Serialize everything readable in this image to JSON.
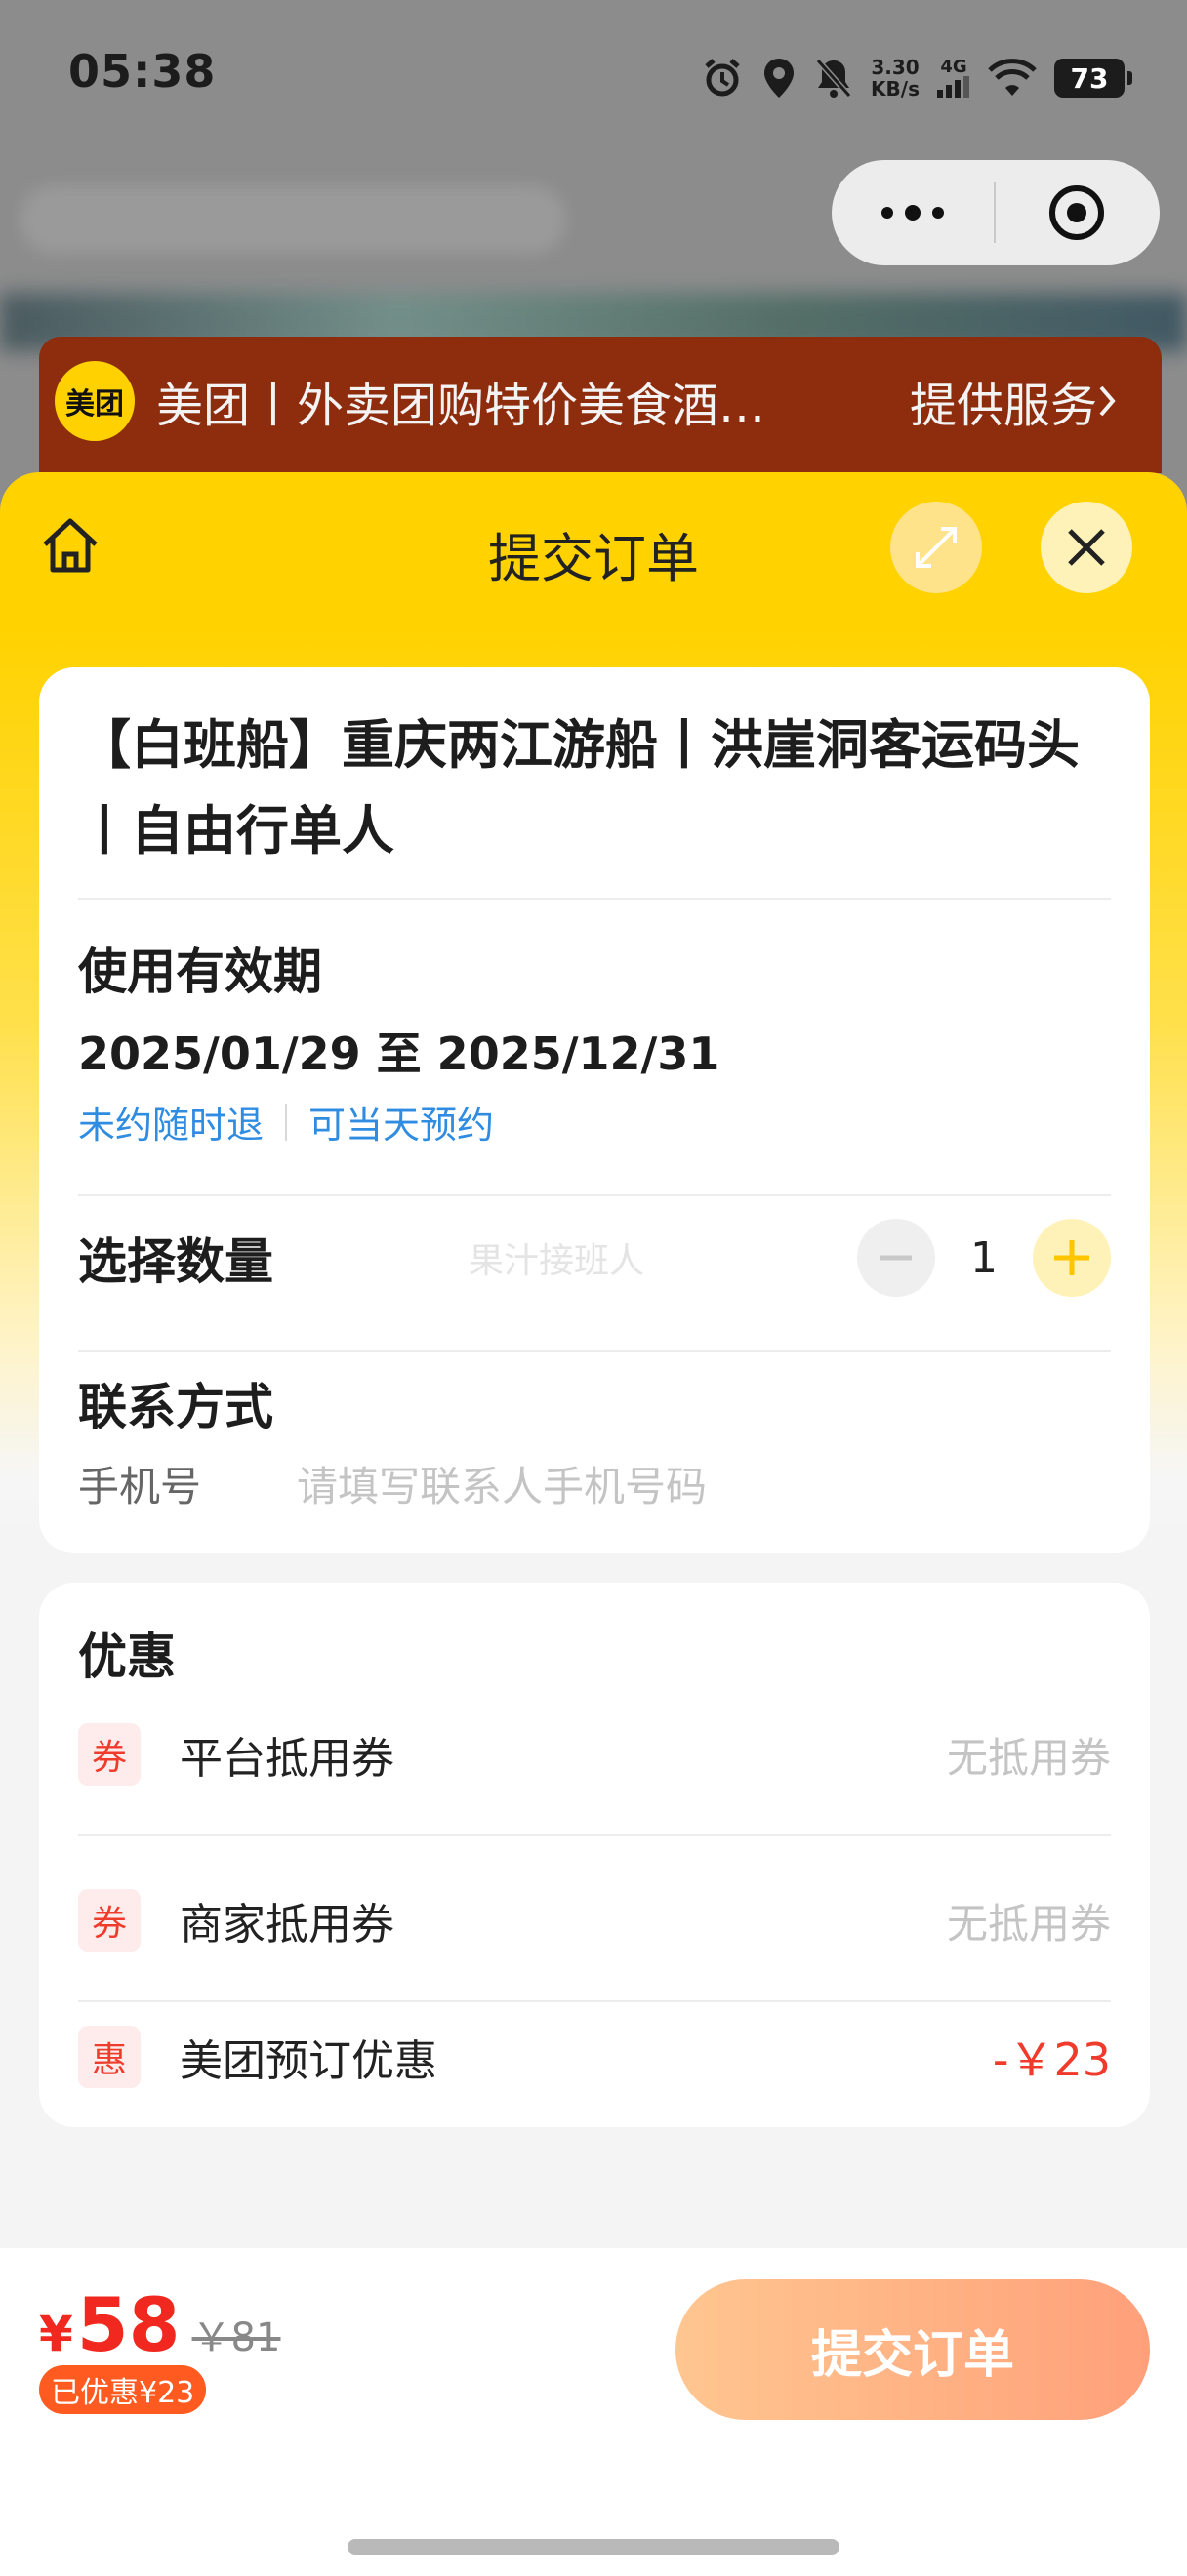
{
  "status_bar": {
    "time": "05:38",
    "net_speed_value": "3.30",
    "net_speed_unit": "KB/s",
    "network_type": "4G",
    "battery": "73"
  },
  "service_banner": {
    "logo_text": "美团",
    "title": "美团丨外卖团购特价美食酒…",
    "right_text": "提供服务"
  },
  "sheet": {
    "title": "提交订单"
  },
  "product": {
    "title": "【白班船】重庆两江游船丨洪崖洞客运码头丨自由行单人"
  },
  "validity": {
    "label": "使用有效期",
    "dates": "2025/01/29 至 2025/12/31",
    "tags": [
      "未约随时退",
      "可当天预约"
    ]
  },
  "quantity": {
    "label": "选择数量",
    "watermark": "果汁接班人",
    "value": "1"
  },
  "contact": {
    "label": "联系方式",
    "phone_label": "手机号",
    "phone_placeholder": "请填写联系人手机号码"
  },
  "discounts": {
    "title": "优惠",
    "items": [
      {
        "badge": "券",
        "name": "平台抵用券",
        "value": "无抵用券"
      },
      {
        "badge": "券",
        "name": "商家抵用券",
        "value": "无抵用券"
      },
      {
        "badge": "惠",
        "name": "美团预订优惠",
        "value": "-￥23"
      }
    ]
  },
  "footer": {
    "currency": "¥",
    "price": "58",
    "original_price": "￥81",
    "saved_text": "已优惠¥23",
    "submit_label": "提交订单"
  },
  "colors": {
    "brand_yellow": "#ffd200",
    "price_red": "#f0281f",
    "link_blue": "#2f8ce0",
    "submit_gradient_start": "#ffc690",
    "submit_gradient_end": "#ffa07a"
  }
}
